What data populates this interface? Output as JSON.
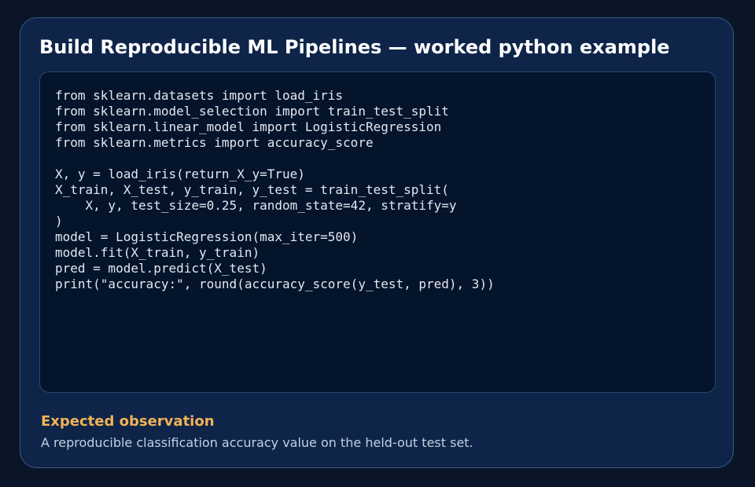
{
  "card": {
    "title": "Build Reproducible ML Pipelines — worked python example",
    "code": {
      "language": "python",
      "lines": [
        "from sklearn.datasets import load_iris",
        "from sklearn.model_selection import train_test_split",
        "from sklearn.linear_model import LogisticRegression",
        "from sklearn.metrics import accuracy_score",
        "",
        "X, y = load_iris(return_X_y=True)",
        "X_train, X_test, y_train, y_test = train_test_split(",
        "    X, y, test_size=0.25, random_state=42, stratify=y",
        ")",
        "model = LogisticRegression(max_iter=500)",
        "model.fit(X_train, y_train)",
        "pred = model.predict(X_test)",
        "print(\"accuracy:\", round(accuracy_score(y_test, pred), 3))"
      ]
    },
    "observation": {
      "heading": "Expected observation",
      "text": "A reproducible classification accuracy value on the held-out test set."
    }
  },
  "colors": {
    "page_background": "#0a1628",
    "card_background": "#0e2449",
    "card_border": "#3a5a86",
    "code_background": "#03142b",
    "code_text": "#e3e8ef",
    "title_text": "#ffffff",
    "heading_accent": "#f1b255",
    "body_text": "#c3d0e2"
  }
}
